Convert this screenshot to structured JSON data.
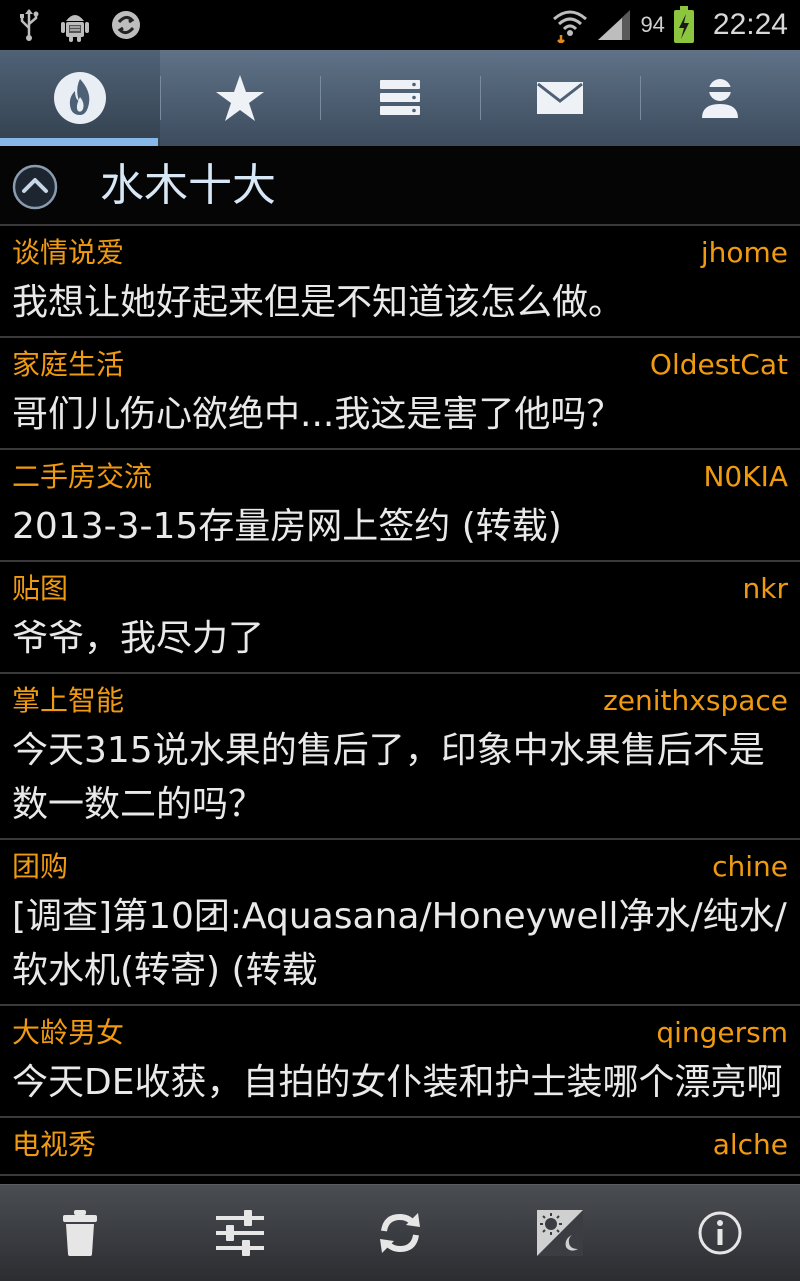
{
  "status_bar": {
    "icons_left": [
      "usb-icon",
      "android-debug-icon",
      "sync-app-icon"
    ],
    "battery_percent": "94",
    "time": "22:24"
  },
  "tabs": [
    {
      "icon": "hot-icon",
      "active": true
    },
    {
      "icon": "star-icon",
      "active": false
    },
    {
      "icon": "boards-icon",
      "active": false
    },
    {
      "icon": "mail-icon",
      "active": false
    },
    {
      "icon": "user-icon",
      "active": false
    }
  ],
  "section": {
    "title": "水木十大"
  },
  "items": [
    {
      "board": "谈情说爱",
      "author": "jhome",
      "title": "我想让她好起来但是不知道该怎么做。"
    },
    {
      "board": "家庭生活",
      "author": "OldestCat",
      "title": "哥们儿伤心欲绝中...我这是害了他吗？"
    },
    {
      "board": "二手房交流",
      "author": "N0KIA",
      "title": "2013-3-15存量房网上签约 (转载)"
    },
    {
      "board": "贴图",
      "author": "nkr",
      "title": "爷爷，我尽力了"
    },
    {
      "board": "掌上智能",
      "author": "zenithxspace",
      "title": "今天315说水果的售后了，印象中水果售后不是数一数二的吗？"
    },
    {
      "board": "团购",
      "author": "chine",
      "title": "[调查]第10团:Aquasana/Honeywell净水/纯水/软水机(转寄) (转载"
    },
    {
      "board": "大龄男女",
      "author": "qingersm",
      "title": "今天DE收获，自拍的女仆装和护士装哪个漂亮啊"
    },
    {
      "board": "电视秀",
      "author": "alche",
      "title": ""
    }
  ],
  "bottom_bar": [
    "trash-icon",
    "settings-sliders-icon",
    "refresh-icon",
    "day-night-icon",
    "info-icon"
  ],
  "colors": {
    "accent_orange": "#ef9a10",
    "tab_indicator": "#86b8e8",
    "title_blue": "#d7e7f6"
  }
}
